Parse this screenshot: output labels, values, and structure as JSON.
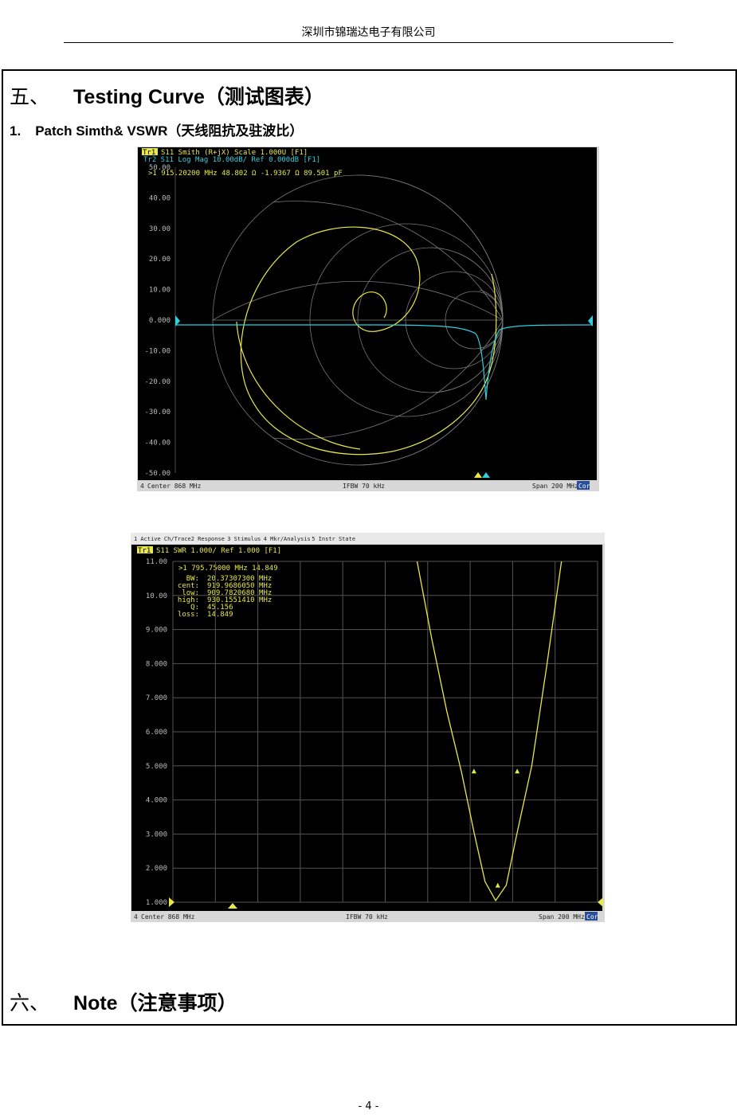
{
  "header": {
    "company": "深圳市锦瑞达电子有限公司"
  },
  "section5": {
    "number": "五、",
    "title": "Testing Curve（测试图表）"
  },
  "subsection1": {
    "number": "1.",
    "title": "Patch Simth& VSWR（天线阻抗及驻波比）"
  },
  "smith_plot": {
    "tr1_tag": "Tr1",
    "tr1_label": "S11 Smith (R+jX) Scale 1.000U [F1]",
    "tr2_label": "Tr2 S11 Log Mag 10.00dB/ Ref 0.000dB [F1]",
    "marker_readout": ">1   915.20200 MHz   48.802 Ω  -1.9367 Ω   89.501 pF",
    "y_ticks": [
      "50.00",
      "40.00",
      "30.00",
      "20.00",
      "10.00",
      "0.000",
      "-10.00",
      "-20.00",
      "-30.00",
      "-40.00",
      "-50.00"
    ],
    "footer_channel": "4",
    "footer_center": "Center 868 MHz",
    "footer_ifbw": "IFBW 70 kHz",
    "footer_span": "Span 200 MHz",
    "footer_cor": "Cor",
    "colors": {
      "smith_trace": "#e8e84a",
      "logmag_trace": "#2fd0e0",
      "background": "#000000"
    }
  },
  "vswr_plot": {
    "menu": [
      "1 Active Ch/Trace",
      "2 Response",
      "3 Stimulus",
      "4 Mkr/Analysis",
      "5 Instr State"
    ],
    "tr_tag": "Tr1",
    "tr_label": "S11 SWR 1.000/ Ref 1.000 [F1]",
    "marker_readout": ">1   795.75000 MHz   14.849",
    "stats": [
      {
        "k": "BW:",
        "v": "20.37307300 MHz"
      },
      {
        "k": "cent:",
        "v": "919.9686050 MHz"
      },
      {
        "k": "low:",
        "v": "909.7820680 MHz"
      },
      {
        "k": "high:",
        "v": "930.1551410 MHz"
      },
      {
        "k": "Q:",
        "v": "45.156"
      },
      {
        "k": "loss:",
        "v": "14.849"
      }
    ],
    "y_ticks": [
      "11.00",
      "10.00",
      "9.000",
      "8.000",
      "7.000",
      "6.000",
      "5.000",
      "4.000",
      "3.000",
      "2.000",
      "1.000"
    ],
    "footer_channel": "4",
    "footer_center": "Center 868 MHz",
    "footer_ifbw": "IFBW 70 kHz",
    "footer_span": "Span 200 MHz",
    "footer_cor": "Cor",
    "chart_data": {
      "type": "line",
      "x_range_mhz": [
        768,
        968
      ],
      "ylim": [
        1,
        11
      ],
      "x": [
        883,
        890,
        897,
        904,
        910,
        915,
        920,
        925,
        930,
        937,
        944,
        951
      ],
      "series": [
        {
          "values": [
            11,
            8.7,
            6.6,
            4.8,
            3.0,
            1.6,
            1.05,
            1.5,
            3.0,
            5.0,
            7.9,
            11
          ]
        }
      ]
    }
  },
  "section6": {
    "number": "六、",
    "title": "Note（注意事项）"
  },
  "page_number": "- 4 -"
}
